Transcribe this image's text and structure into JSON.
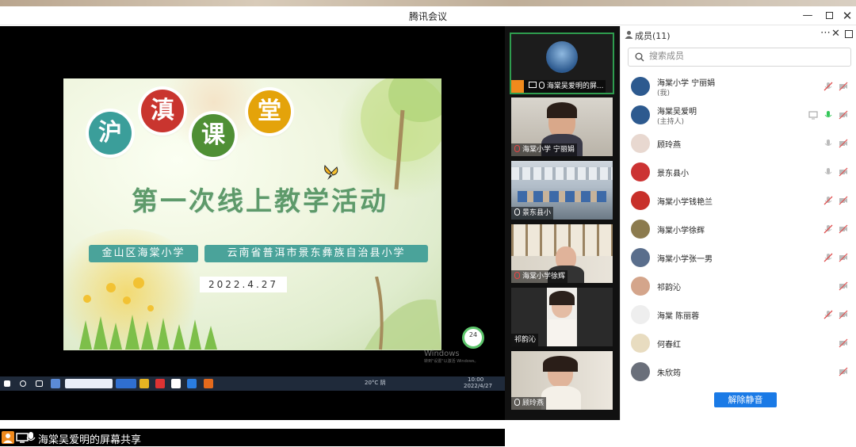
{
  "window": {
    "title": "腾讯会议",
    "buttons": [
      "minimize",
      "maximize",
      "close"
    ]
  },
  "slide": {
    "circles": [
      {
        "char": "沪",
        "color": "#3b9e9a"
      },
      {
        "char": "滇",
        "color": "#c9352f"
      },
      {
        "char": "课",
        "color": "#4f8f35"
      },
      {
        "char": "堂",
        "color": "#e4a30a"
      }
    ],
    "title": "第一次线上教学活动",
    "banner_left": "金山区海棠小学",
    "banner_right": "云南省普洱市景东彝族自治县小学",
    "date": "2022.4.27",
    "badge": "24",
    "watermark_line1": "Windows",
    "watermark_line2": "转到\"设置\"以激活 Windows。"
  },
  "taskbar": {
    "weather": "20°C 阴",
    "clock_time": "10:00",
    "clock_date": "2022/4/27"
  },
  "share_bar": {
    "label": "海棠吴爱明的屏幕共享"
  },
  "thumbnails": [
    {
      "name": "海棠吴爱明的屏...",
      "active": true
    },
    {
      "name": "海棠小学 宁丽娟",
      "active": false
    },
    {
      "name": "景东县小",
      "active": false
    },
    {
      "name": "海棠小学徐辉",
      "active": false
    },
    {
      "name": "祁韵沁",
      "active": false
    },
    {
      "name": "顾玲燕",
      "active": false
    }
  ],
  "members_panel": {
    "title": "成员(11)",
    "search_placeholder": "搜索成员",
    "unmute_all_label": "解除静音",
    "members": [
      {
        "name": "海棠小学 宁丽娟",
        "sub": "(我)",
        "avatar_color": "#2d5a8f",
        "mic": "muted",
        "video": "off"
      },
      {
        "name": "海棠吴爱明",
        "sub": "(主持人)",
        "avatar_color": "#2d5a8f",
        "mic": "on",
        "video": "off",
        "sharing": true
      },
      {
        "name": "顾玲燕",
        "sub": "",
        "avatar_color": "#e8d8d0",
        "mic": "idle",
        "video": "off"
      },
      {
        "name": "景东县小",
        "sub": "",
        "avatar_color": "#cc3333",
        "mic": "idle",
        "video": "off"
      },
      {
        "name": "海棠小学钱艳兰",
        "sub": "",
        "avatar_color": "#c8302a",
        "mic": "muted",
        "video": "off"
      },
      {
        "name": "海棠小学徐辉",
        "sub": "",
        "avatar_color": "#8c7b4e",
        "mic": "muted",
        "video": "off"
      },
      {
        "name": "海棠小学张一男",
        "sub": "",
        "avatar_color": "#5a6e8c",
        "mic": "muted",
        "video": "off"
      },
      {
        "name": "祁韵沁",
        "sub": "",
        "avatar_color": "#d4a58b",
        "mic": "none",
        "video": "off"
      },
      {
        "name": "海棠 陈丽蓉",
        "sub": "",
        "avatar_color": "#eeeeee",
        "mic": "muted",
        "video": "off"
      },
      {
        "name": "何春红",
        "sub": "",
        "avatar_color": "#e8dcc0",
        "mic": "none",
        "video": "off"
      },
      {
        "name": "朱欣筠",
        "sub": "",
        "avatar_color": "#6a6f7a",
        "mic": "none",
        "video": "off"
      }
    ]
  }
}
